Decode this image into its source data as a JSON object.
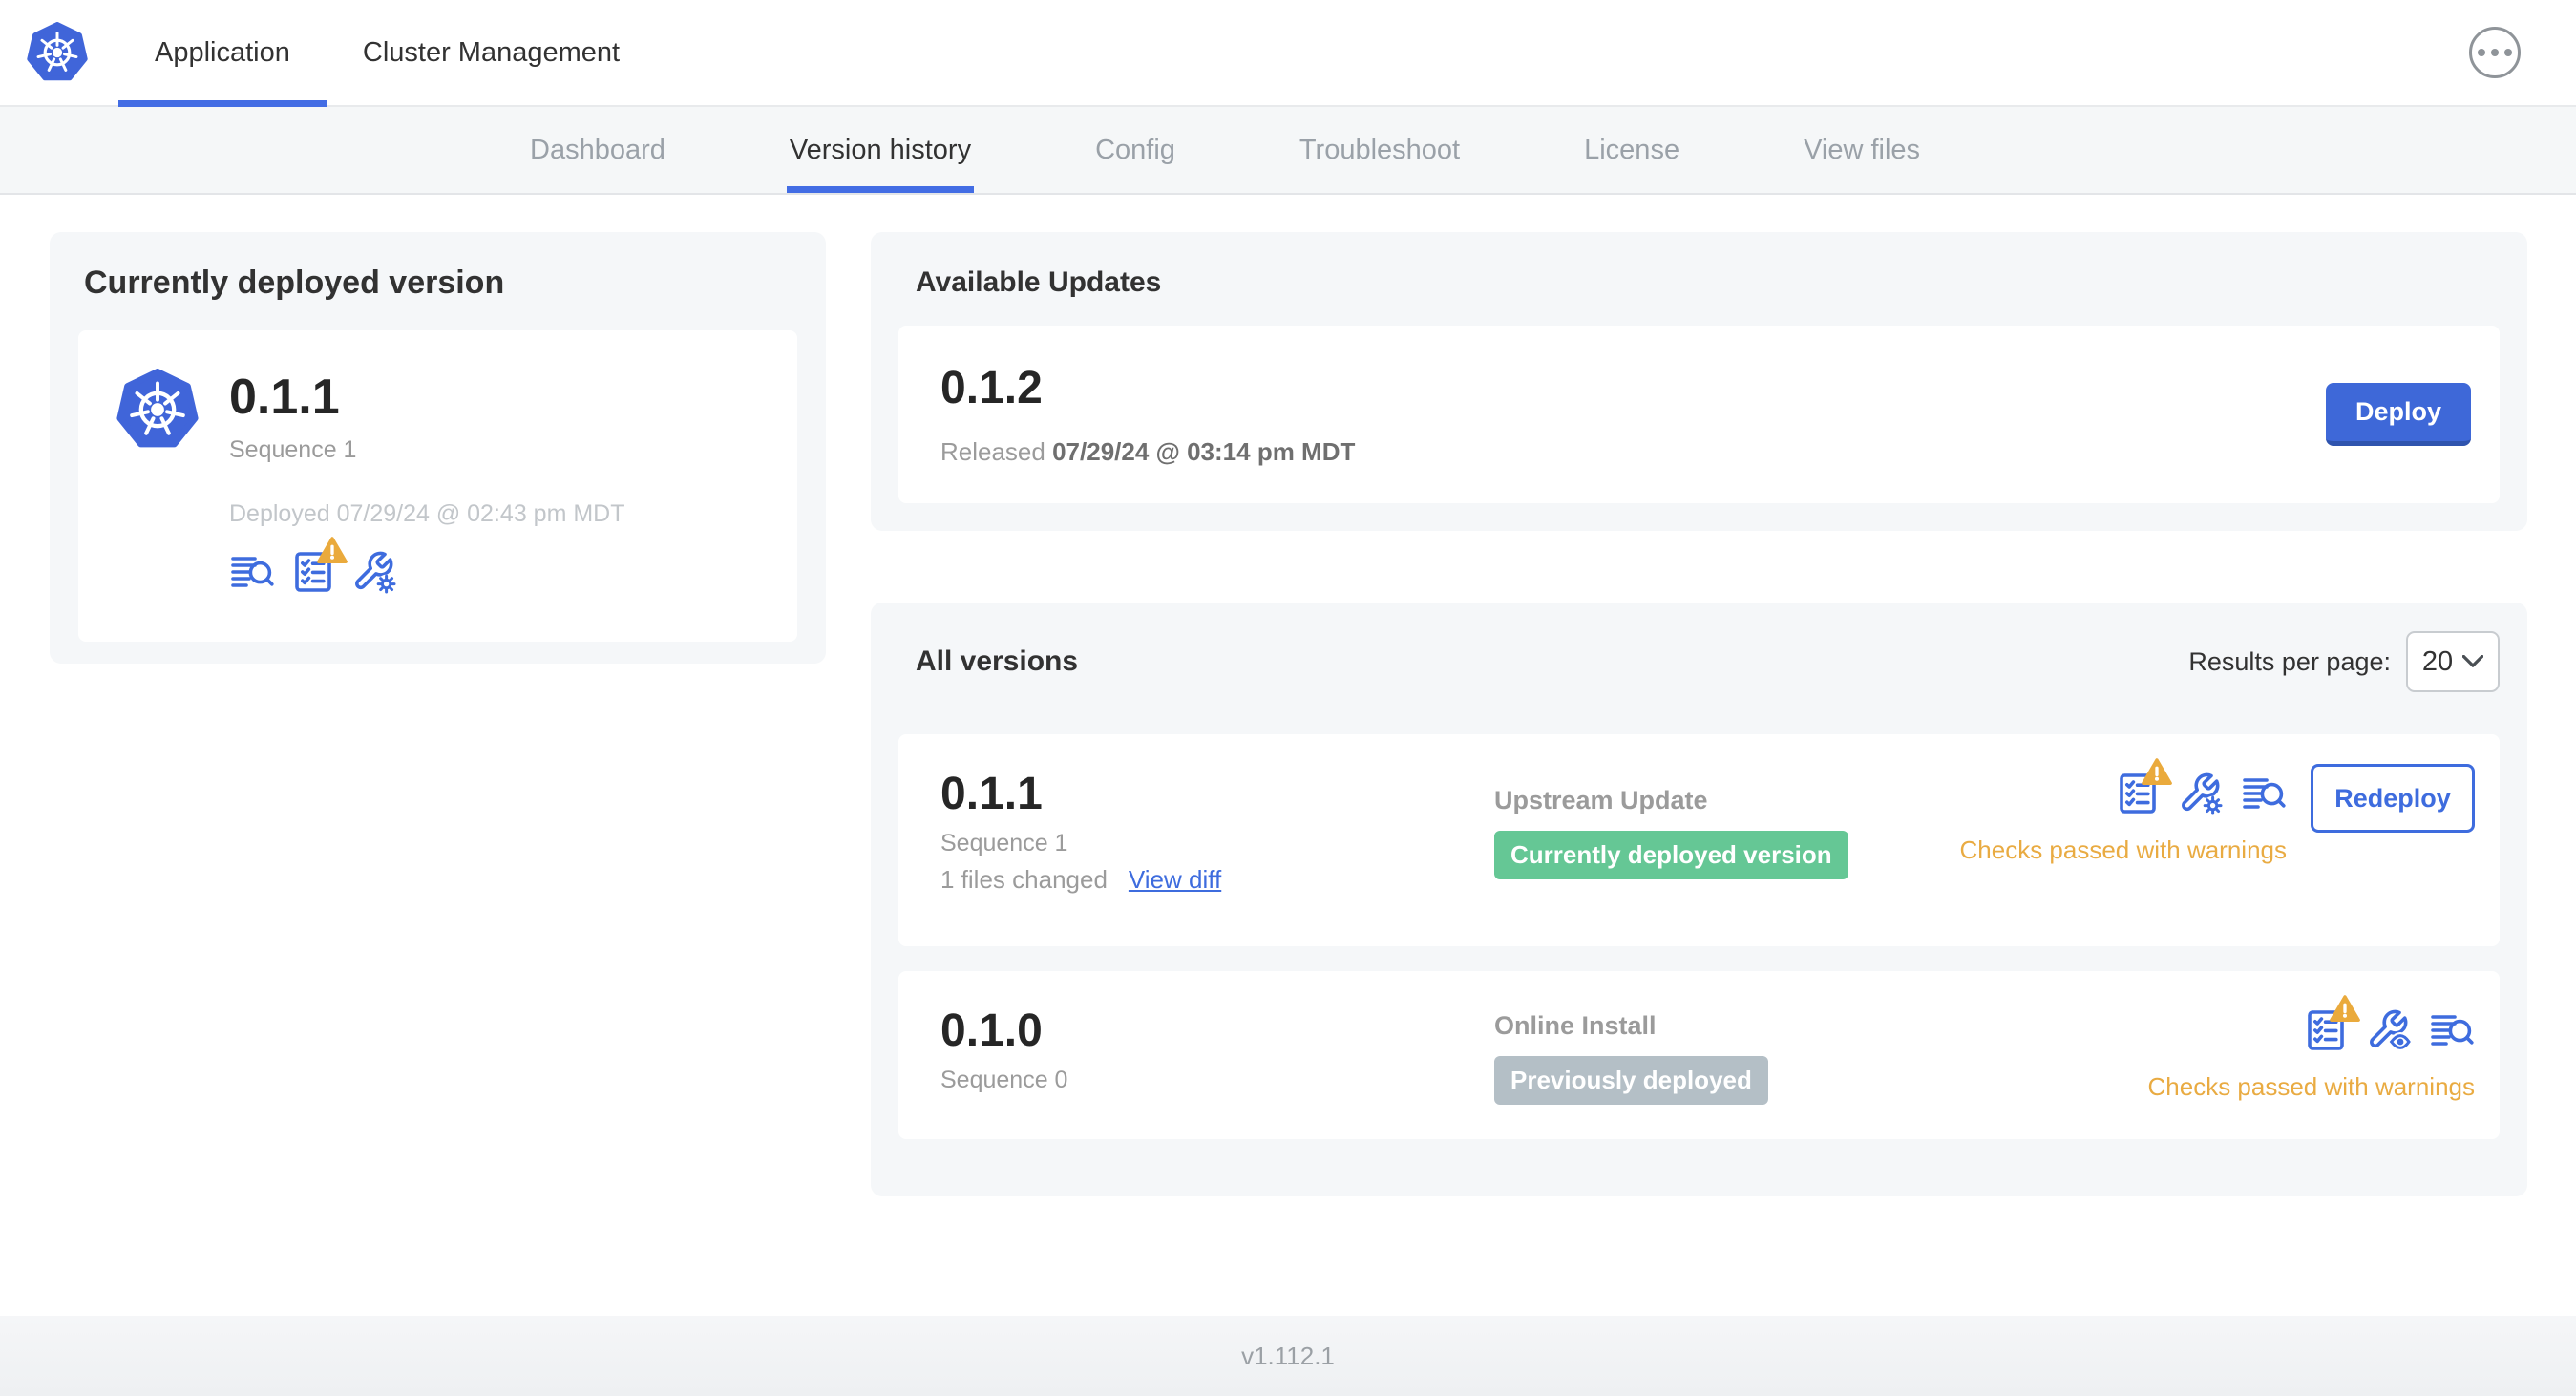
{
  "header": {
    "app_tab": "Application",
    "cluster_tab": "Cluster Management"
  },
  "subnav": {
    "items": [
      "Dashboard",
      "Version history",
      "Config",
      "Troubleshoot",
      "License",
      "View files"
    ],
    "active": "Version history"
  },
  "current_version_card": {
    "title": "Currently deployed version",
    "version": "0.1.1",
    "sequence": "Sequence 1",
    "deployed_text": "Deployed 07/29/24 @ 02:43 pm MDT",
    "icons": [
      "release-notes-icon",
      "preflight-checks-warning-icon",
      "edit-config-icon"
    ]
  },
  "available_updates_card": {
    "title": "Available Updates",
    "version": "0.1.2",
    "released_prefix": "Released",
    "released_date": "07/29/24 @ 03:14 pm MDT",
    "deploy_button": "Deploy"
  },
  "all_versions_card": {
    "title": "All versions",
    "results_per_page_label": "Results per page:",
    "results_per_page_value": "20",
    "rows": [
      {
        "version": "0.1.1",
        "sequence": "Sequence 1",
        "files_changed": "1 files changed",
        "view_diff": "View diff",
        "source": "Upstream Update",
        "badge": "Currently deployed version",
        "badge_color": "#65c795",
        "icons": [
          "preflight-checks-warning-icon",
          "edit-config-icon",
          "release-notes-icon"
        ],
        "action": "Redeploy",
        "status": "Checks passed with warnings"
      },
      {
        "version": "0.1.0",
        "sequence": "Sequence 0",
        "source": "Online Install",
        "badge": "Previously deployed",
        "badge_color": "#b4bfc6",
        "icons": [
          "preflight-checks-warning-icon",
          "view-config-icon",
          "release-notes-icon"
        ],
        "status": "Checks passed with warnings"
      }
    ]
  },
  "footer": {
    "version": "v1.112.1"
  },
  "colors": {
    "accent_blue": "#3e6cde",
    "active_tab_underline": "#436de4",
    "badge_green": "#65c795",
    "badge_gray": "#b4bfc6",
    "warning_text": "#e9ab42",
    "warning_triangle": "#eaaa3c",
    "card_background": "#f5f7f9"
  }
}
